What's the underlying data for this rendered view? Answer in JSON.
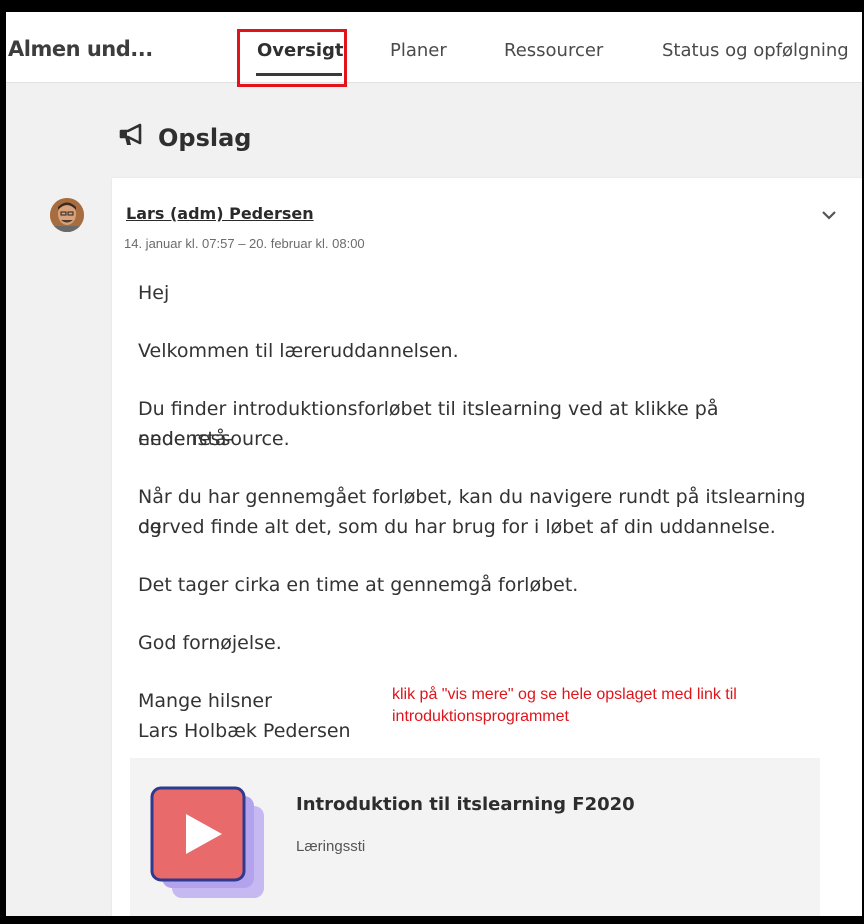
{
  "header": {
    "course_title": "Almen und...",
    "tabs": [
      {
        "label": "Oversigt",
        "active": true
      },
      {
        "label": "Planer"
      },
      {
        "label": "Ressourcer"
      },
      {
        "label": "Status og opfølgning"
      }
    ]
  },
  "section": {
    "title": "Opslag",
    "icon": "megaphone-icon"
  },
  "post": {
    "author": "Lars (adm) Pedersen",
    "dates": "14. januar kl. 07:57 – 20. februar kl. 08:00",
    "lines": [
      "Hej",
      "Velkommen til læreruddannelsen.",
      "Du finder introduktionsforløbet til itslearning ved at klikke på nedenstå-",
      "ende ressource.",
      "Når du har gennemgået forløbet, kan du navigere rundt på itslearning og",
      "derved finde alt det, som du har brug for i løbet af din uddannelse.",
      "Det tager cirka en time at gennemgå forløbet.",
      "God fornøjelse.",
      "Mange hilsner",
      "Lars Holbæk Pedersen"
    ],
    "annotation": "klik på \"vis mere\" og se hele opslaget med link til introduktionsprogrammet",
    "resource": {
      "title": "Introduktion til itslearning F2020",
      "type": "Læringssti",
      "icon": "play-icon"
    }
  },
  "colors": {
    "highlight": "#e0141a",
    "play_tile": "#e86a6a",
    "tile_border": "#2f3a8f",
    "tile_shadow": "#c6b9f2"
  }
}
